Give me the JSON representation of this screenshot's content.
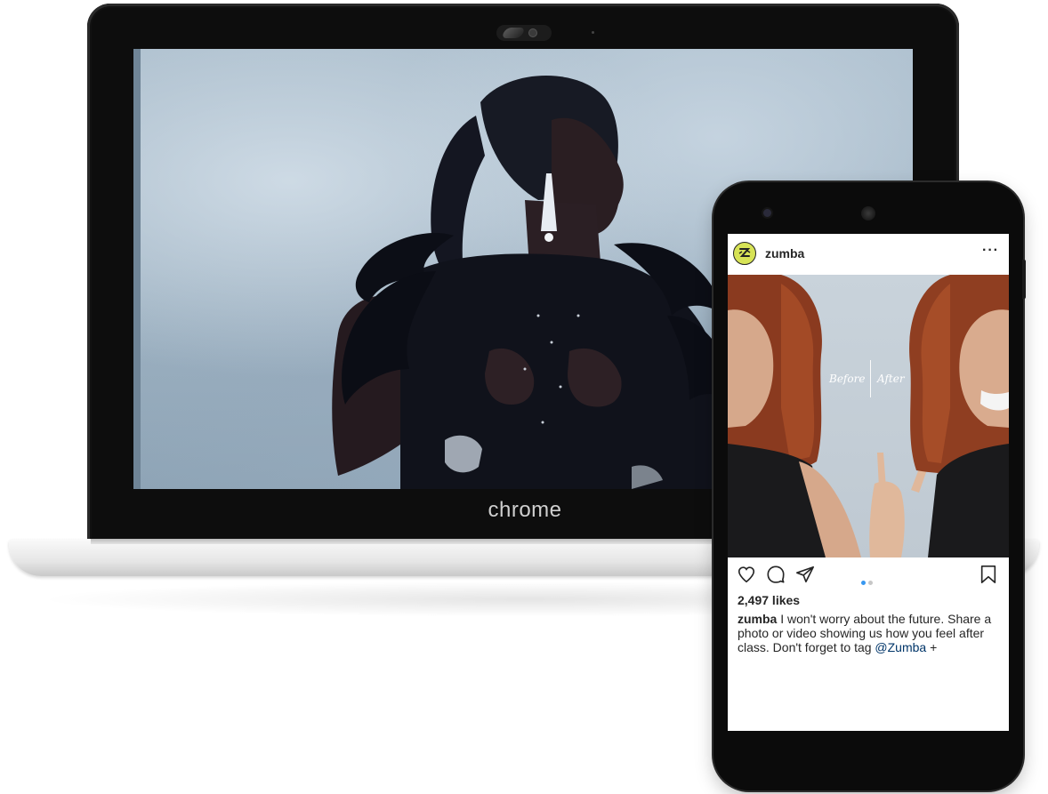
{
  "laptop": {
    "brand_label": "chrome",
    "screen_content": "video-frame"
  },
  "instagram_post": {
    "username": "zumba",
    "more_options": "···",
    "photo_labels": {
      "before": "Before",
      "after": "After"
    },
    "likes": "2,497 likes",
    "caption": {
      "user": "zumba",
      "text": " I won't worry about the future.  Share a photo or video showing us how you feel after class. Don't forget to tag ",
      "tag": "@Zumba",
      "suffix": " +"
    },
    "carousel": {
      "active_index": 0,
      "count": 2,
      "active_color": "#3897f0",
      "inactive_color": "#c7c7c7"
    },
    "icons": {
      "like": "heart-icon",
      "comment": "comment-icon",
      "share": "share-icon",
      "save": "bookmark-icon",
      "avatar": "zumba-logo-icon"
    }
  },
  "colors": {
    "laptop_bezel": "#0d0d0d",
    "instagram_text": "#262626",
    "mention_link": "#003569",
    "zumba_logo_bg": "#d7e356"
  }
}
